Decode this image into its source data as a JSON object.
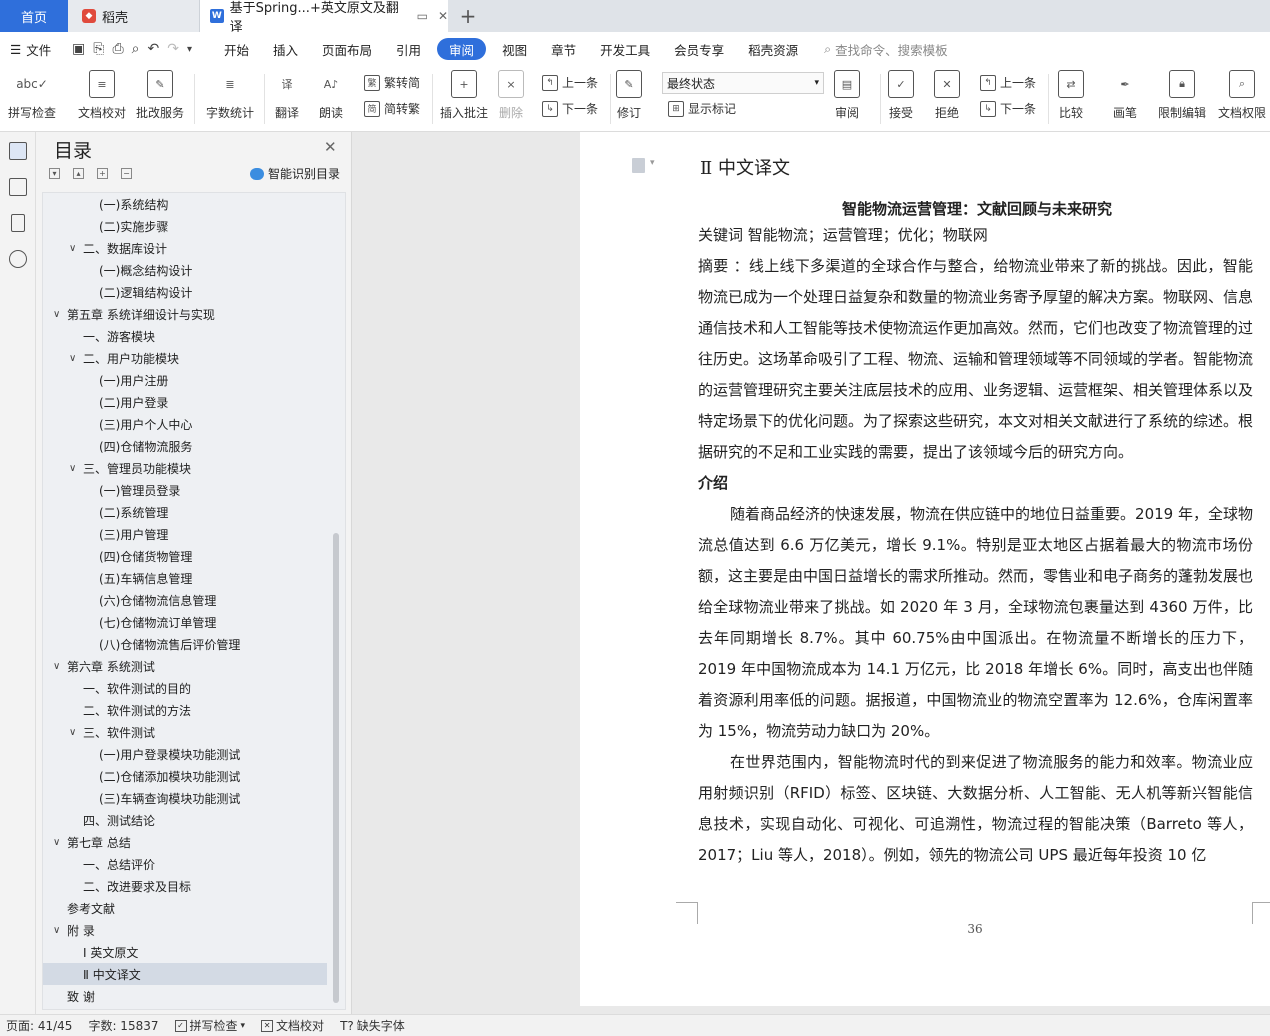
{
  "tabs": {
    "home": "首页",
    "daoke": "稻壳",
    "doc": "基于Spring...+英文原文及翻译",
    "add": "+"
  },
  "menu": {
    "file": "文件",
    "items": [
      "开始",
      "插入",
      "页面布局",
      "引用",
      "审阅",
      "视图",
      "章节",
      "开发工具",
      "会员专享",
      "稻壳资源"
    ],
    "active": "审阅",
    "search_placeholder": "查找命令、搜索模板"
  },
  "ribbon": {
    "spell": "拼写检查",
    "doc_check": "文档校对",
    "batch_service": "批改服务",
    "word_count": "字数统计",
    "translate": "翻译",
    "read_aloud": "朗读",
    "trad_simp": "繁转简",
    "simp_trad": "简转繁",
    "insert_comment": "插入批注",
    "delete": "删除",
    "prev": "上一条",
    "next": "下一条",
    "revise": "修订",
    "final_state": "最终状态",
    "show_markup": "显示标记",
    "review": "审阅",
    "accept": "接受",
    "reject": "拒绝",
    "prev2": "上一条",
    "next2": "下一条",
    "compare": "比较",
    "ink": "画笔",
    "restrict_edit": "限制编辑",
    "doc_rights": "文档权限"
  },
  "toc": {
    "title": "目录",
    "ai_label": "智能识别目录",
    "items": [
      {
        "text": "(一)系统结构",
        "level": 3,
        "arrow": false
      },
      {
        "text": "(二)实施步骤",
        "level": 3,
        "arrow": false
      },
      {
        "text": "二、数据库设计",
        "level": 2,
        "arrow": true
      },
      {
        "text": "(一)概念结构设计",
        "level": 3,
        "arrow": false
      },
      {
        "text": "(二)逻辑结构设计",
        "level": 3,
        "arrow": false
      },
      {
        "text": "第五章  系统详细设计与实现",
        "level": 1,
        "arrow": true
      },
      {
        "text": "一、游客模块",
        "level": 2,
        "arrow": false
      },
      {
        "text": "二、用户功能模块",
        "level": 2,
        "arrow": true
      },
      {
        "text": "(一)用户注册",
        "level": 3,
        "arrow": false
      },
      {
        "text": "(二)用户登录",
        "level": 3,
        "arrow": false
      },
      {
        "text": "(三)用户个人中心",
        "level": 3,
        "arrow": false
      },
      {
        "text": "(四)仓储物流服务",
        "level": 3,
        "arrow": false
      },
      {
        "text": "三、管理员功能模块",
        "level": 2,
        "arrow": true
      },
      {
        "text": "(一)管理员登录",
        "level": 3,
        "arrow": false
      },
      {
        "text": "(二)系统管理",
        "level": 3,
        "arrow": false
      },
      {
        "text": "(三)用户管理",
        "level": 3,
        "arrow": false
      },
      {
        "text": "(四)仓储货物管理",
        "level": 3,
        "arrow": false
      },
      {
        "text": "(五)车辆信息管理",
        "level": 3,
        "arrow": false
      },
      {
        "text": "(六)仓储物流信息管理",
        "level": 3,
        "arrow": false
      },
      {
        "text": "(七)仓储物流订单管理",
        "level": 3,
        "arrow": false
      },
      {
        "text": "(八)仓储物流售后评价管理",
        "level": 3,
        "arrow": false
      },
      {
        "text": "第六章  系统测试",
        "level": 1,
        "arrow": true
      },
      {
        "text": "一、软件测试的目的",
        "level": 2,
        "arrow": false
      },
      {
        "text": "二、软件测试的方法",
        "level": 2,
        "arrow": false
      },
      {
        "text": "三、软件测试",
        "level": 2,
        "arrow": true
      },
      {
        "text": "(一)用户登录模块功能测试",
        "level": 3,
        "arrow": false
      },
      {
        "text": "(二)仓储添加模块功能测试",
        "level": 3,
        "arrow": false
      },
      {
        "text": "(三)车辆查询模块功能测试",
        "level": 3,
        "arrow": false
      },
      {
        "text": "四、测试结论",
        "level": 2,
        "arrow": false
      },
      {
        "text": "第七章  总结",
        "level": 1,
        "arrow": true
      },
      {
        "text": "一、总结评价",
        "level": 2,
        "arrow": false
      },
      {
        "text": "二、改进要求及目标",
        "level": 2,
        "arrow": false
      },
      {
        "text": "参考文献",
        "level": 1,
        "arrow": false
      },
      {
        "text": "附    录",
        "level": 1,
        "arrow": true
      },
      {
        "text": "Ⅰ  英文原文",
        "level": 2,
        "arrow": false
      },
      {
        "text": "Ⅱ  中文译文",
        "level": 2,
        "arrow": false,
        "selected": true
      },
      {
        "text": "致    谢",
        "level": 1,
        "arrow": false
      }
    ]
  },
  "document": {
    "section_heading": "Ⅱ  中文译文",
    "title": "智能物流运营管理：文献回顾与未来研究",
    "keywords": "关键词  智能物流；运营管理；优化；物联网",
    "abstract": "摘要  ：线上线下多渠道的全球合作与整合，给物流业带来了新的挑战。因此，智能物流已成为一个处理日益复杂和数量的物流业务寄予厚望的解决方案。物联网、信息通信技术和人工智能等技术使物流运作更加高效。然而，它们也改变了物流管理的过往历史。这场革命吸引了工程、物流、运输和管理领域等不同领域的学者。智能物流的运营管理研究主要关注底层技术的应用、业务逻辑、运营框架、相关管理体系以及特定场景下的优化问题。为了探索这些研究，本文对相关文献进行了系统的综述。根据研究的不足和工业实践的需要，提出了该领域今后的研究方向。",
    "intro_heading": "介绍",
    "para1": "随着商品经济的快速发展，物流在供应链中的地位日益重要。2019 年，全球物流总值达到 6.6 万亿美元，增长 9.1%。特别是亚太地区占据着最大的物流市场份额，这主要是由中国日益增长的需求所推动。然而，零售业和电子商务的蓬勃发展也给全球物流业带来了挑战。如 2020 年 3 月，全球物流包裹量达到 4360 万件，比去年同期增长 8.7%。其中 60.75%由中国派出。在物流量不断增长的压力下，2019 年中国物流成本为 14.1 万亿元，比 2018 年增长 6%。同时，高支出也伴随着资源利用率低的问题。据报道，中国物流业的物流空置率为 12.6%，仓库闲置率为 15%，物流劳动力缺口为 20%。",
    "para2": "在世界范围内，智能物流时代的到来促进了物流服务的能力和效率。物流业应用射频识别（RFID）标签、区块链、大数据分析、人工智能、无人机等新兴智能信息技术，实现自动化、可视化、可追溯性，物流过程的智能决策（Barreto 等人，2017；Liu 等人，2018）。例如，领先的物流公司 UPS 最近每年投资 10 亿",
    "page_number": "36"
  },
  "status": {
    "page": "页面: 41/45",
    "words": "字数: 15837",
    "spell": "拼写检查",
    "doc_check": "文档校对",
    "missing_font": "缺失字体"
  },
  "colors": {
    "accent": "#2f6fdb",
    "selected_row": "#d3dae4"
  }
}
